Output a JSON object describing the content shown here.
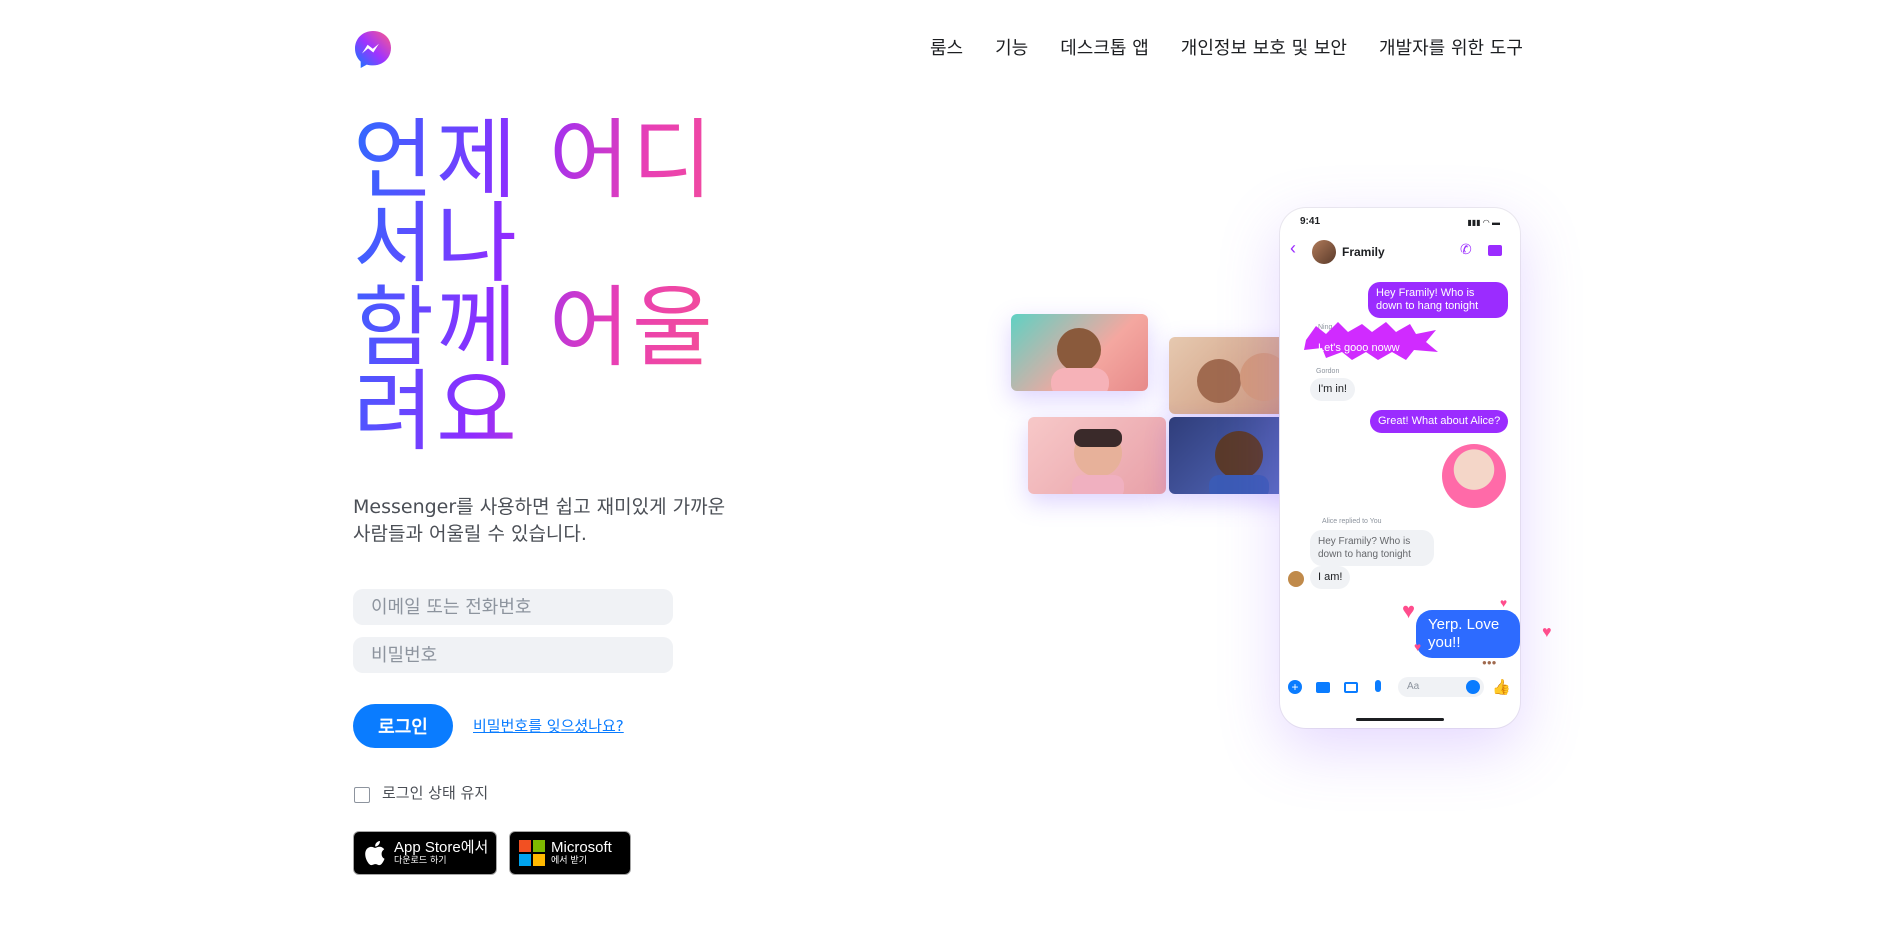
{
  "nav": {
    "items": [
      "룸스",
      "기능",
      "데스크톱 앱",
      "개인정보 보호 및 보안",
      "개발자를 위한 도구"
    ]
  },
  "hero": {
    "lines": [
      "언제 어디",
      "서나",
      "함께 어울",
      "려요"
    ]
  },
  "subtitle": {
    "line1": "Messenger를 사용하면 쉽고 재미있게 가까운",
    "line2": "사람들과 어울릴 수 있습니다."
  },
  "form": {
    "email_placeholder": "이메일 또는 전화번호",
    "password_placeholder": "비밀번호",
    "login_label": "로그인",
    "forgot_label": "비밀번호를 잊으셨나요?",
    "remember_label": "로그인 상태 유지"
  },
  "stores": {
    "apple_line1": "App Store에서",
    "apple_line2": "다운로드 하기",
    "ms_line1": "Microsoft",
    "ms_line2": "에서 받기"
  },
  "phone": {
    "time": "9:41",
    "chat_name": "Framily",
    "messages": {
      "m1": "Hey Framily! Who is down to hang tonight",
      "ning_name": "Ning",
      "m2": "Let's gooo noww",
      "gordon_name": "Gordon",
      "m3": "I'm in!",
      "m4": "Great! What about Alice?",
      "reply_note": "Alice replied to You",
      "m5": "Hey Framily? Who is down to hang tonight",
      "m6": "I am!",
      "m7": "Yerp. Love you!!"
    },
    "composer_placeholder": "Aa"
  },
  "colors": {
    "accent": "#0a7cff",
    "purple": "#9b2cff",
    "pink": "#ff5d7a"
  }
}
